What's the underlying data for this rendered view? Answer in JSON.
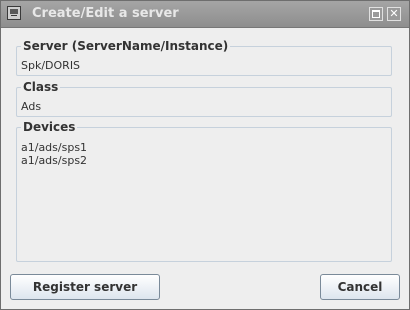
{
  "window": {
    "title": "Create/Edit a server",
    "maximize_icon": "maximize-icon",
    "close_glyph": "✕"
  },
  "server": {
    "label": "Server  (ServerName/Instance)",
    "value": "Spk/DORIS"
  },
  "class": {
    "label": "Class",
    "value": "Ads"
  },
  "devices": {
    "label": "Devices",
    "items": [
      "a1/ads/sps1",
      "a1/ads/sps2"
    ]
  },
  "buttons": {
    "register": "Register server",
    "cancel": "Cancel"
  },
  "colors": {
    "titlebar": "#999999",
    "background": "#eeeeee",
    "group_border": "#c6d1dc",
    "button_border": "#7a8a99"
  }
}
